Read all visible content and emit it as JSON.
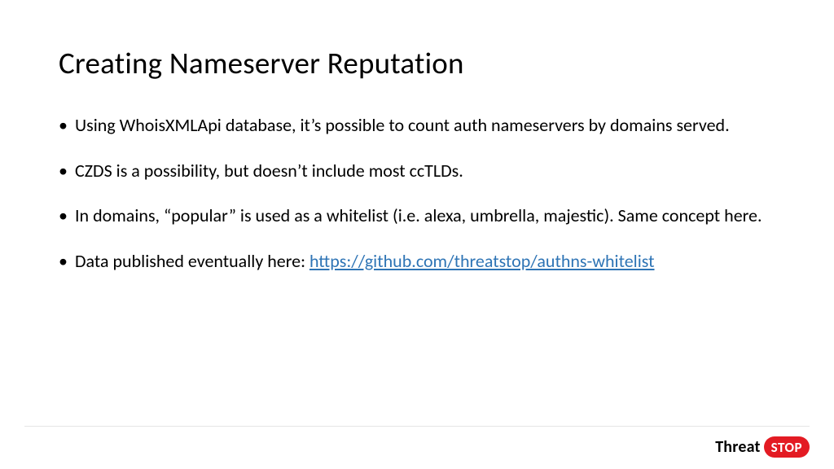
{
  "slide": {
    "title": "Creating Nameserver Reputation",
    "bullets": [
      {
        "text": "Using WhoisXMLApi database, it’s possible to count auth nameservers by domains served."
      },
      {
        "text": "CZDS is a possibility, but doesn’t include most ccTLDs."
      },
      {
        "text": "In domains, “popular” is used as a whitelist (i.e. alexa, umbrella, majestic). Same concept here."
      },
      {
        "text": "Data published eventually here: ",
        "link": "https://github.com/threatstop/authns-whitelist"
      }
    ]
  },
  "footer": {
    "logo_part1": "Threat",
    "logo_part2": "STOP"
  }
}
